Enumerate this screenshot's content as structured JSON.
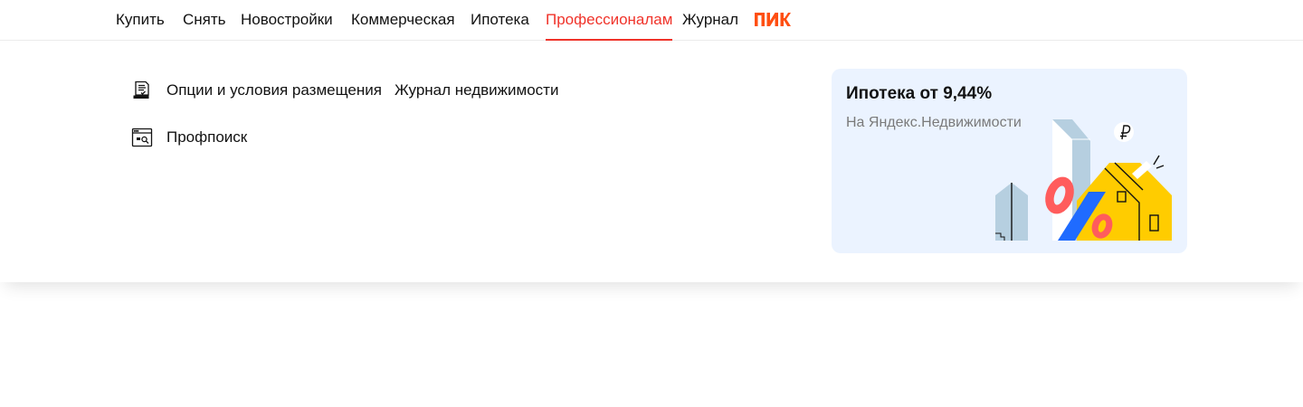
{
  "nav": {
    "items": [
      {
        "label": "Купить"
      },
      {
        "label": "Снять"
      },
      {
        "label": "Новостройки"
      },
      {
        "label": "Коммерческая"
      },
      {
        "label": "Ипотека"
      },
      {
        "label": "Профессионалам",
        "active": true
      },
      {
        "label": "Журнал"
      }
    ],
    "partner_logo": "ПИК",
    "accent_color": "#f0332a",
    "logo_color": "#ff4f12"
  },
  "menu": {
    "items": [
      {
        "label": "Опции и условия размещения",
        "icon": "document-list-icon"
      },
      {
        "label": "Журнал недвижимости"
      },
      {
        "label": "Профпоиск",
        "icon": "browser-search-icon"
      }
    ]
  },
  "promo": {
    "title": "Ипотека от 9,44%",
    "subtitle": "На Яндекс.Недвижимости",
    "background": "#ebf3ff",
    "art": "house-percent-illustration"
  }
}
